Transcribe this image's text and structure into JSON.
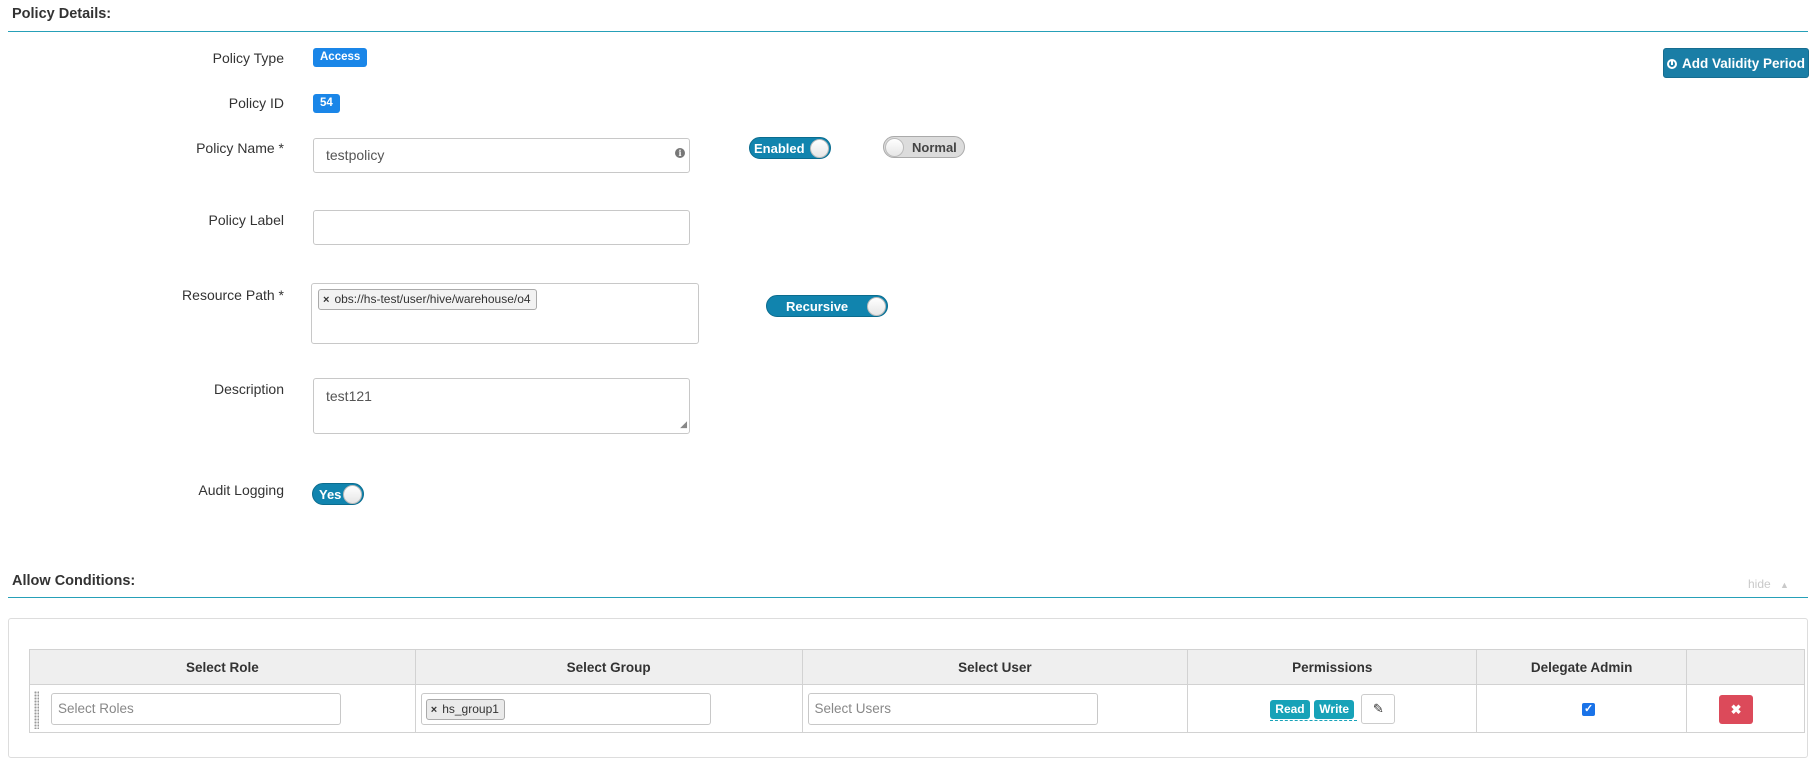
{
  "policy_details": {
    "heading": "Policy Details:",
    "add_validity_label": "Add Validity Period",
    "policy_type": {
      "label": "Policy Type",
      "value": "Access"
    },
    "policy_id": {
      "label": "Policy ID",
      "value": "54"
    },
    "policy_name": {
      "label": "Policy Name *",
      "value": "testpolicy"
    },
    "enabled_toggle": "Enabled",
    "normal_toggle": "Normal",
    "policy_label": {
      "label": "Policy Label",
      "value": ""
    },
    "resource_path": {
      "label": "Resource Path *",
      "tag": "obs://hs-test/user/hive/warehouse/o4"
    },
    "recursive_toggle": "Recursive",
    "description": {
      "label": "Description",
      "value": "test121"
    },
    "audit_logging": {
      "label": "Audit Logging",
      "value": "Yes"
    }
  },
  "allow_conditions": {
    "heading": "Allow Conditions:",
    "hide_label": "hide",
    "columns": [
      "Select Role",
      "Select Group",
      "Select User",
      "Permissions",
      "Delegate Admin"
    ],
    "row": {
      "roles_placeholder": "Select Roles",
      "group_tag": "hs_group1",
      "users_placeholder": "Select Users",
      "permissions": [
        "Read",
        "Write"
      ],
      "delegate_admin": true
    }
  }
}
